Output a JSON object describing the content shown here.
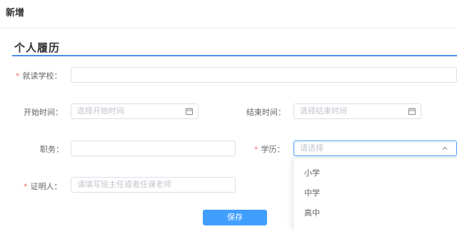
{
  "page": {
    "title": "新增"
  },
  "section": {
    "title": "个人履历"
  },
  "form": {
    "school": {
      "label": "就读学校：",
      "required": "*",
      "value": ""
    },
    "start_time": {
      "label": "开始时间：",
      "placeholder": "选择开始时间",
      "icon": "calendar-icon"
    },
    "end_time": {
      "label": "结束时间：",
      "placeholder": "选择结束时间",
      "icon": "calendar-icon"
    },
    "position": {
      "label": "职务：",
      "value": ""
    },
    "education": {
      "label": "学历：",
      "required": "*",
      "placeholder": "请选择",
      "icon": "chevron-up-icon",
      "options": [
        "小学",
        "中学",
        "高中"
      ]
    },
    "witness": {
      "label": "证明人：",
      "required": "*",
      "placeholder": "请填写班主任或者任课老师"
    },
    "save_label": "保存"
  },
  "colors": {
    "accent": "#409eff",
    "required": "#f56c6c",
    "section_line": "#4a90e2"
  }
}
